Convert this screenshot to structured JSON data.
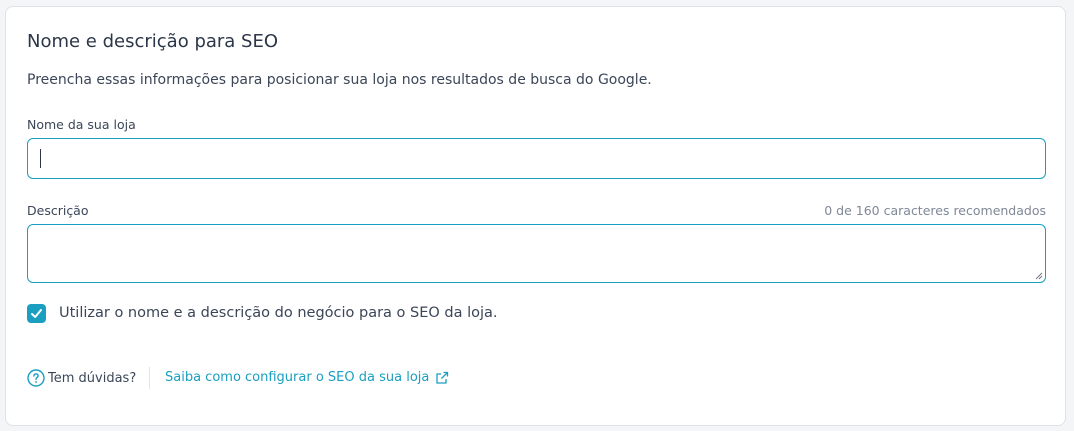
{
  "section": {
    "title": "Nome e descrição para SEO",
    "subtitle": "Preencha essas informações para posicionar sua loja nos resultados de busca do Google."
  },
  "store_name_field": {
    "label": "Nome da sua loja",
    "value": "",
    "placeholder": ""
  },
  "description_field": {
    "label": "Descrição",
    "counter": "0 de 160 caracteres recomendados",
    "value": "",
    "placeholder": ""
  },
  "use_business_checkbox": {
    "label": "Utilizar o nome e a descrição do negócio para o SEO da loja.",
    "checked": true
  },
  "help": {
    "question": "Tem dúvidas?",
    "link_text": "Saiba como configurar o SEO da sua loja"
  },
  "colors": {
    "accent": "#1a9fc0",
    "text": "#2b3648",
    "muted": "#7f8897",
    "border": "#dfe2e8"
  },
  "icons": {
    "help": "question-circle-icon",
    "external": "external-link-icon",
    "check": "checkmark-icon"
  }
}
